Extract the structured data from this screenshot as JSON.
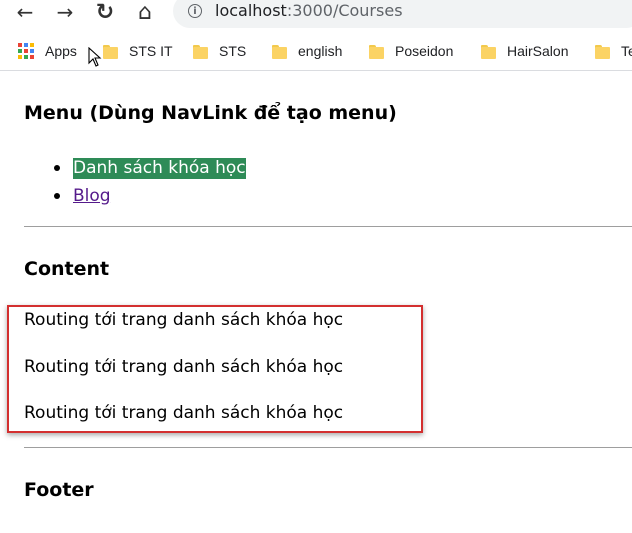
{
  "browser": {
    "back_glyph": "←",
    "forward_glyph": "→",
    "reload_glyph": "↻",
    "home_glyph": "⌂",
    "info_glyph": "i",
    "url_host": "localhost",
    "url_path": ":3000/Courses"
  },
  "bookmarks": {
    "apps_label": "Apps",
    "items": [
      "STS IT",
      "STS",
      "english",
      "Poseidon",
      "HairSalon",
      "Te"
    ]
  },
  "menu": {
    "title": "Menu (Dùng NavLink để tạo menu)",
    "items": [
      {
        "label": "Danh sách khóa học",
        "active": true
      },
      {
        "label": "Blog",
        "active": false
      }
    ]
  },
  "content": {
    "title": "Content",
    "lines": [
      "Routing tới trang danh sách khóa học",
      "Routing tới trang danh sách khóa học",
      "Routing tới trang danh sách khóa học"
    ]
  },
  "footer": {
    "title": "Footer"
  },
  "colors": {
    "active_nav_bg": "#2e8b57",
    "highlight_border": "#d32f2f",
    "visited_link": "#551a8b",
    "folder": "#fbd364"
  }
}
